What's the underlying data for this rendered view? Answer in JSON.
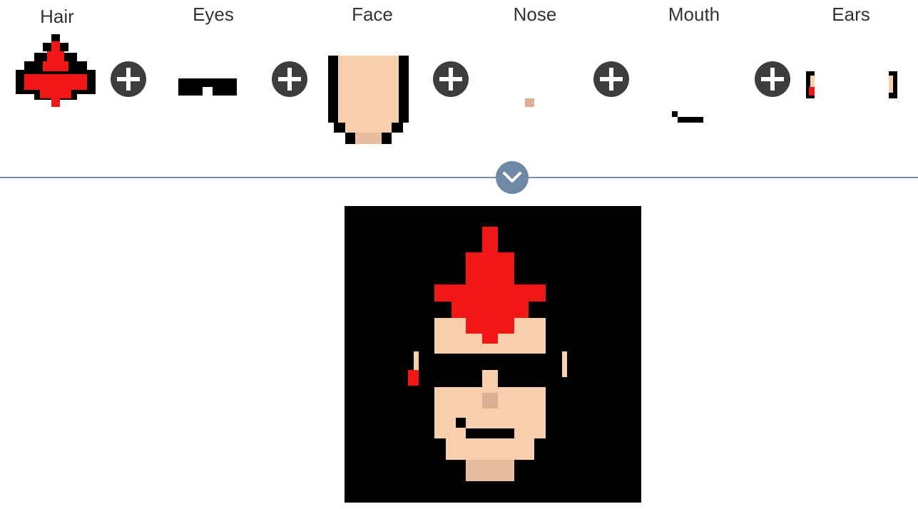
{
  "parts": {
    "hair": {
      "label": "Hair"
    },
    "eyes": {
      "label": "Eyes"
    },
    "face": {
      "label": "Face"
    },
    "nose": {
      "label": "Nose"
    },
    "mouth": {
      "label": "Mouth"
    },
    "ears": {
      "label": "Ears"
    }
  },
  "colors": {
    "hair_red": "#f21616",
    "skin": "#f8cfad",
    "nose": "#dcae93",
    "black": "#000000",
    "plus_button": "#3d3d3d",
    "divider": "#7990a8",
    "collapse_button": "#6d89a5"
  },
  "icons": {
    "add": "plus-circle-icon",
    "collapse": "chevron-down-icon"
  }
}
